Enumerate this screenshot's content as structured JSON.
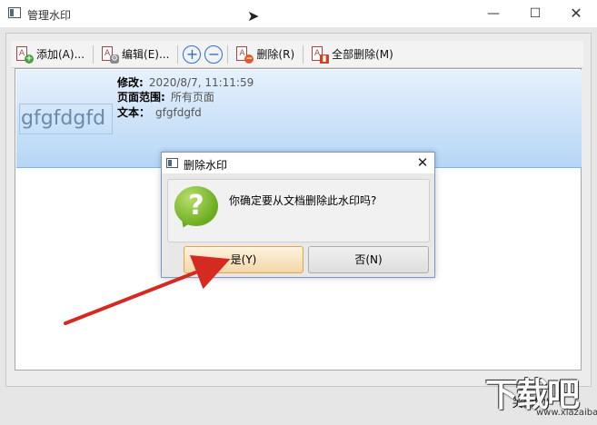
{
  "window": {
    "title": "管理水印",
    "min_glyph": "—",
    "max_glyph": "☐",
    "close_glyph": "✕"
  },
  "toolbar": {
    "add_label": "添加(A)...",
    "edit_label": "编辑(E)...",
    "plus_glyph": "+",
    "minus_glyph": "−",
    "delete_label": "删除(R)",
    "delete_all_label": "全部删除(M)"
  },
  "watermarks": [
    {
      "preview_text": "gfgfdgfd",
      "modified_label": "修改:",
      "modified_value": "2020/8/7, 11:11:59",
      "page_range_label": "页面范围:",
      "page_range_value": "所有页面",
      "text_label": "文本：",
      "text_value": "gfgfdgfd"
    }
  ],
  "dialog": {
    "title": "删除水印",
    "close_glyph": "✕",
    "icon_glyph": "?",
    "message": "你确定要从文档删除此水印吗?",
    "yes_label": "是(Y)",
    "no_label": "否(N)"
  },
  "footer": {
    "close_label": "关闭(C)"
  },
  "logo": {
    "big": "下载吧",
    "small": "www.xiazaiba.com"
  },
  "colors": {
    "selection_top": "#e6f1fc",
    "selection_bottom": "#b6d6f6",
    "accent_blue": "#2b6fd6",
    "arrow_red": "#d42a22",
    "yes_border": "#e2a547"
  }
}
